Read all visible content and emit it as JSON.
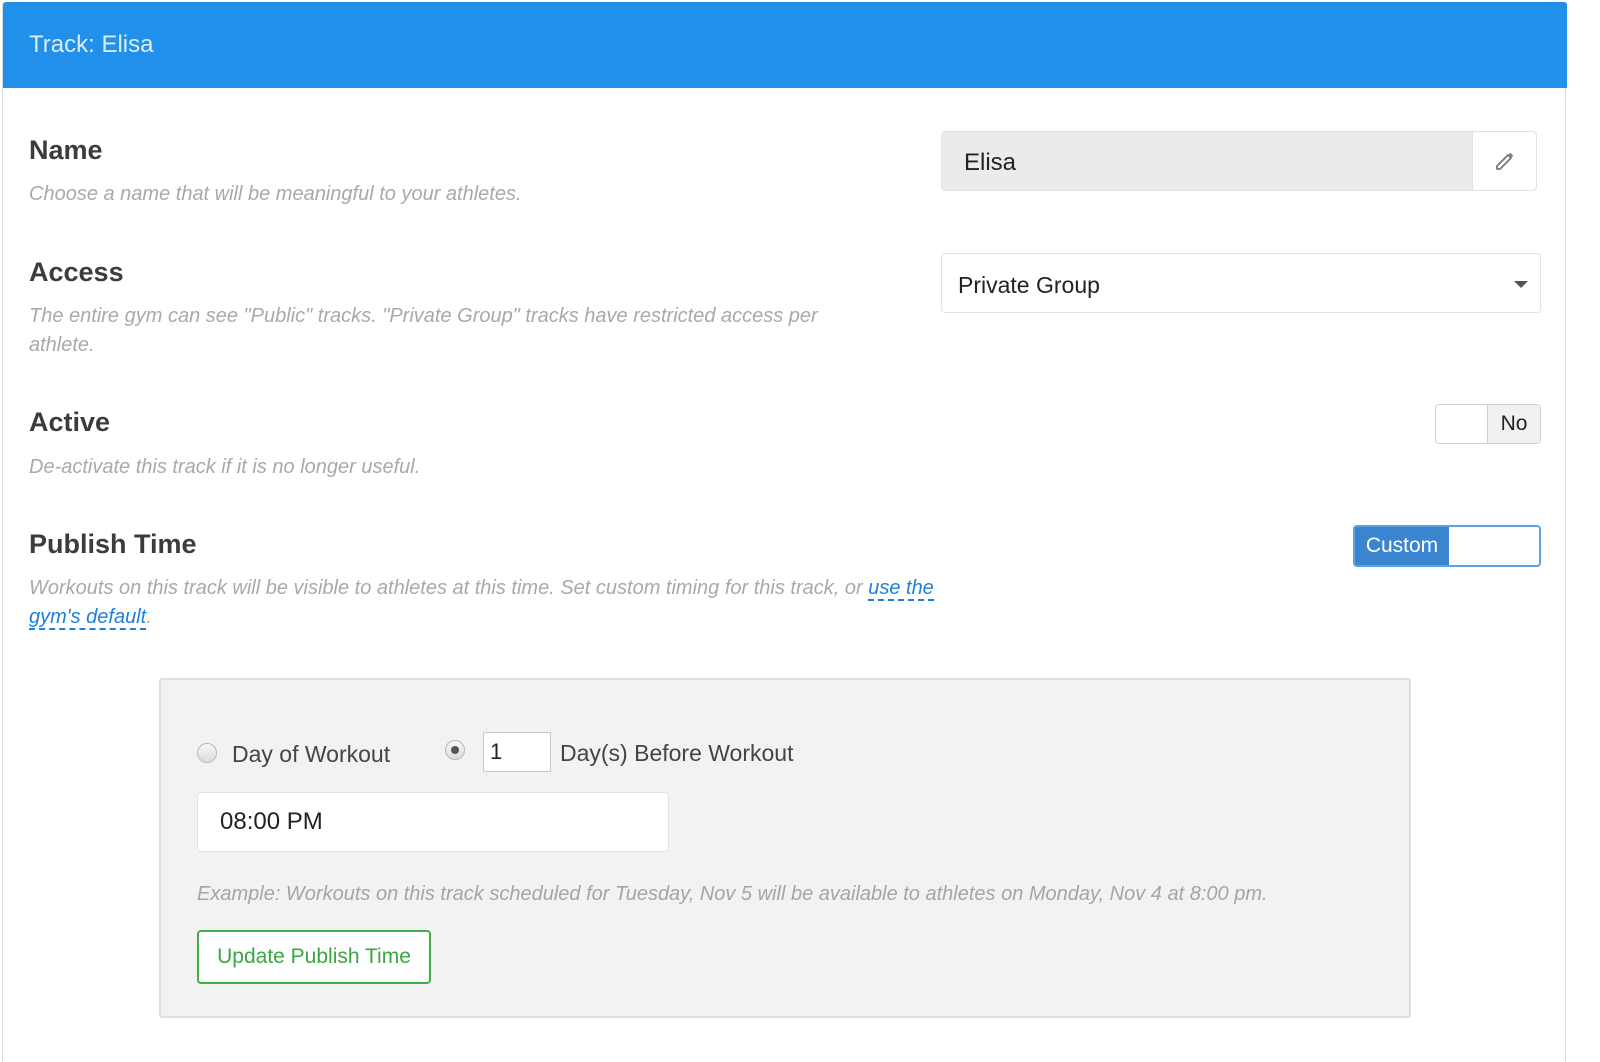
{
  "header": {
    "title": "Track: Elisa"
  },
  "name": {
    "title": "Name",
    "help": "Choose a name that will be meaningful to your athletes.",
    "value": "Elisa",
    "edit_icon": "pencil-icon"
  },
  "access": {
    "title": "Access",
    "help_line1": "The entire gym can see \"Public\" tracks. \"Private Group\" tracks have restricted access per",
    "help_line2": "athlete.",
    "selected": "Private Group"
  },
  "active": {
    "title": "Active",
    "help": "De-activate this track if it is no longer useful.",
    "toggle_label": "No"
  },
  "publish": {
    "title": "Publish Time",
    "help_line1": "Workouts on this track will be visible to athletes at this time. Set custom timing for this track, or ",
    "link_part1": "use the",
    "link_part2": "gym's default",
    "help_end": ".",
    "toggle_label": "Custom",
    "option_day_of": "Day of Workout",
    "days_value": "1",
    "option_days_before": "Day(s) Before Workout",
    "time_value": "08:00 PM",
    "example": "Example: Workouts on this track scheduled for Tuesday, Nov 5 will be available to athletes on Monday, Nov 4 at 8:00 pm.",
    "update_label": "Update Publish Time"
  },
  "colors": {
    "header_bg": "#2090ea",
    "accent_blue": "#3a84d0",
    "update_green": "#3fb045",
    "link_blue": "#1f80d8"
  }
}
